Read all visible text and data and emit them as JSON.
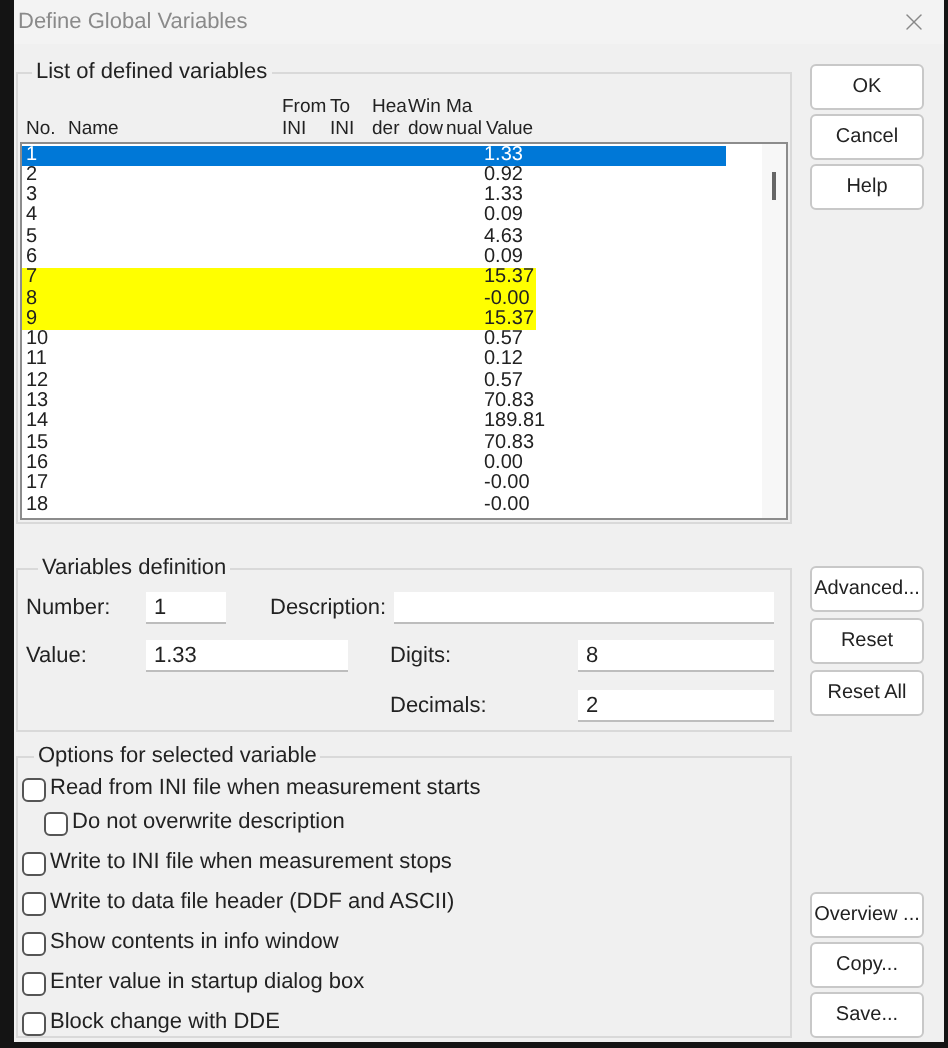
{
  "window": {
    "title": "Define Global Variables"
  },
  "list": {
    "title": "List of defined variables",
    "columns": [
      {
        "lines": [
          "No."
        ]
      },
      {
        "lines": [
          "Name"
        ]
      },
      {
        "lines": [
          "From",
          "INI"
        ]
      },
      {
        "lines": [
          "To",
          "INI"
        ]
      },
      {
        "lines": [
          "Hea",
          "der"
        ]
      },
      {
        "lines": [
          "Win",
          "dow"
        ]
      },
      {
        "lines": [
          "Ma",
          "nual"
        ]
      },
      {
        "lines": [
          "Value"
        ]
      }
    ],
    "rows": [
      {
        "no": "1",
        "value": "1.33",
        "selected": true,
        "highlighted": false
      },
      {
        "no": "2",
        "value": "0.92",
        "selected": false,
        "highlighted": false
      },
      {
        "no": "3",
        "value": "1.33",
        "selected": false,
        "highlighted": false
      },
      {
        "no": "4",
        "value": "0.09",
        "selected": false,
        "highlighted": false
      },
      {
        "no": "5",
        "value": "4.63",
        "selected": false,
        "highlighted": false
      },
      {
        "no": "6",
        "value": "0.09",
        "selected": false,
        "highlighted": false
      },
      {
        "no": "7",
        "value": "15.37",
        "selected": false,
        "highlighted": true
      },
      {
        "no": "8",
        "value": "-0.00",
        "selected": false,
        "highlighted": true
      },
      {
        "no": "9",
        "value": "15.37",
        "selected": false,
        "highlighted": true
      },
      {
        "no": "10",
        "value": "0.57",
        "selected": false,
        "highlighted": false
      },
      {
        "no": "11",
        "value": "0.12",
        "selected": false,
        "highlighted": false
      },
      {
        "no": "12",
        "value": "0.57",
        "selected": false,
        "highlighted": false
      },
      {
        "no": "13",
        "value": "70.83",
        "selected": false,
        "highlighted": false
      },
      {
        "no": "14",
        "value": "189.81",
        "selected": false,
        "highlighted": false
      },
      {
        "no": "15",
        "value": "70.83",
        "selected": false,
        "highlighted": false
      },
      {
        "no": "16",
        "value": "0.00",
        "selected": false,
        "highlighted": false
      },
      {
        "no": "17",
        "value": "-0.00",
        "selected": false,
        "highlighted": false
      },
      {
        "no": "18",
        "value": "-0.00",
        "selected": false,
        "highlighted": false
      }
    ]
  },
  "definition": {
    "title": "Variables definition",
    "number": {
      "label": "Number:",
      "value": "1"
    },
    "description": {
      "label": "Description:"
    },
    "value": {
      "label": "Value:",
      "value": "1.33"
    },
    "digits": {
      "label": "Digits:",
      "value": "8"
    },
    "decimals": {
      "label": "Decimals:",
      "value": "2"
    }
  },
  "options": {
    "title": "Options for selected variable",
    "items": [
      {
        "label": "Read from INI file when measurement starts",
        "checked": false,
        "children": [
          {
            "label": "Do not overwrite description",
            "checked": false
          }
        ]
      },
      {
        "label": "Write to INI file when measurement stops",
        "checked": false
      },
      {
        "label": "Write to data file header (DDF and ASCII)",
        "checked": false
      },
      {
        "label": "Show contents in info window",
        "checked": false
      },
      {
        "label": "Enter value in startup dialog box",
        "checked": false
      },
      {
        "label": "Block change with DDE",
        "checked": false
      }
    ]
  },
  "buttons_top": [
    "OK",
    "Cancel",
    "Help"
  ],
  "buttons_middle": [
    "Advanced...",
    "Reset",
    "Reset All"
  ],
  "buttons_bottom": [
    "Overview ...",
    "Copy...",
    "Save..."
  ]
}
